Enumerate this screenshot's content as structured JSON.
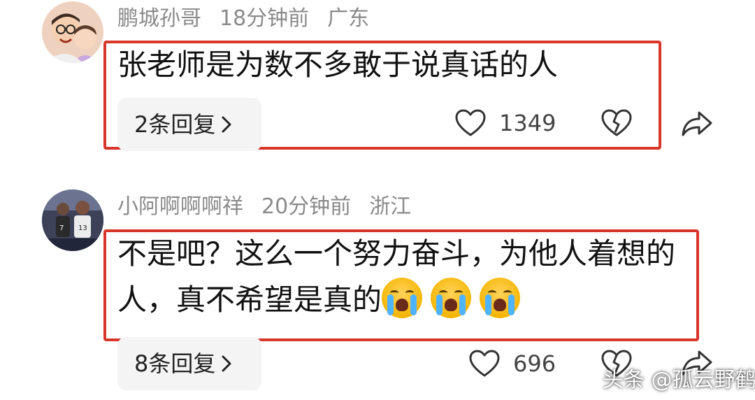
{
  "comments": [
    {
      "username": "鹏城孙哥",
      "time": "18分钟前",
      "location": "广东",
      "content": "张老师是为数不多敢于说真话的人",
      "reply_label": "2条回复",
      "likes": "1349",
      "emoji_count": 0
    },
    {
      "username": "小阿啊啊啊祥",
      "time": "20分钟前",
      "location": "浙江",
      "content": "不是吧？这么一个努力奋斗，为他人着想的人，真不希望是真的",
      "emoji": "crying-face-emoji",
      "emoji_count": 3,
      "reply_label": "8条回复",
      "likes": "696"
    }
  ],
  "watermark": "头条 @孤云野鹤",
  "colors": {
    "highlight_border": "#d9362b",
    "meta_text": "#8a8a8a",
    "reply_bg": "#f4f4f4"
  }
}
